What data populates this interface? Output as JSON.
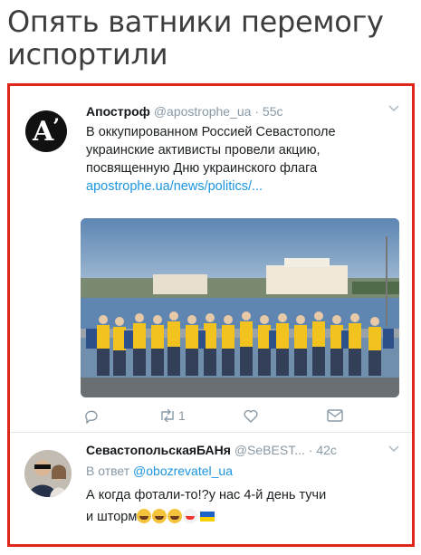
{
  "caption": {
    "line1": "Опять ватники перемогу",
    "line2": "испортили"
  },
  "tweet1": {
    "author": "Апостроф",
    "handle": "@apostrophe_ua",
    "time": "55c",
    "text_lines": [
      "В оккупированном Россией Севастополе",
      "украинские активисты провели акцию,",
      "посвященную Дню украинского флага"
    ],
    "link": "apostrophe.ua/news/politics/...",
    "avatar_letter": "A",
    "retweet_count": "1",
    "icons": [
      "reply-icon",
      "retweet-icon",
      "like-icon",
      "message-icon"
    ]
  },
  "tweet2": {
    "author": "СевастопольскаяБАНя",
    "handle": "@SeBEST...",
    "time": "42c",
    "reply_prefix": "В ответ",
    "reply_handle": "@obozrevatel_ua",
    "text_line1": "А когда фотали-то!?у нас 4-й день тучи",
    "text_line2": "и шторм"
  },
  "colors": {
    "frame": "#e0251b",
    "link": "#1b95e0",
    "muted": "#8899a6"
  }
}
